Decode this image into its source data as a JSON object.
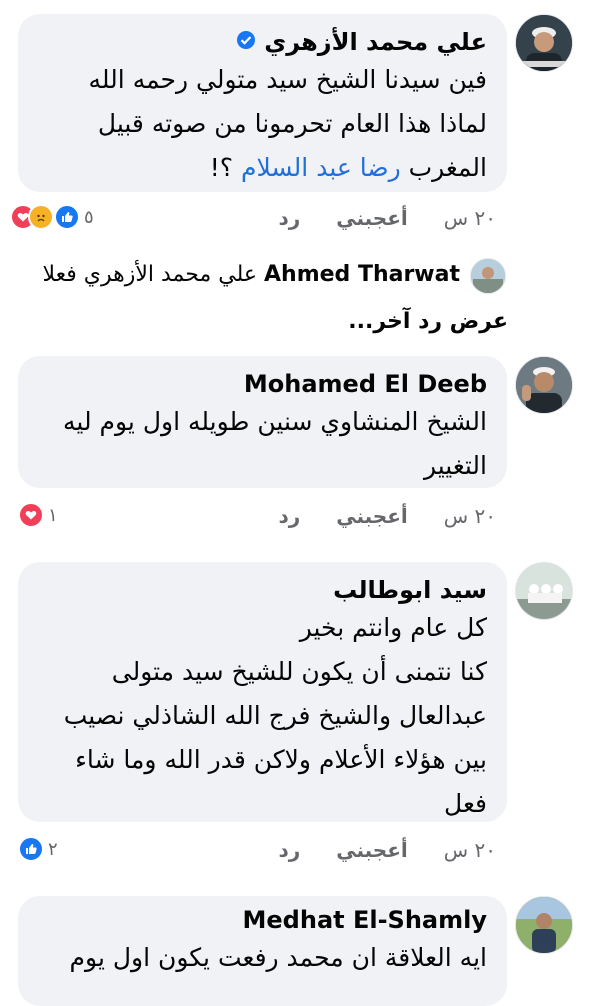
{
  "comments": [
    {
      "author": "علي محمد الأزهري",
      "verified": true,
      "lines": [
        "فين سيدنا الشيخ سيد متولي رحمه الله",
        "لماذا هذا العام تحرمونا من صوته قبيل",
        "المغرب"
      ],
      "mention": "رضا عبد السلام",
      "mention_suffix": " ؟!",
      "time": "٢٠ س",
      "like": "أعجبني",
      "reply": "رد",
      "reaction_count": "٥",
      "reactions": [
        "like-icon",
        "sad-icon",
        "love-icon"
      ]
    },
    {
      "author": "Mohamed El Deeb",
      "lines": [
        "الشيخ المنشاوي سنين طويله اول يوم ليه",
        "التغيير"
      ],
      "time": "٢٠ س",
      "like": "أعجبني",
      "reply": "رد",
      "reaction_count": "١",
      "reactions": [
        "love-icon"
      ]
    },
    {
      "author": "سيد ابوطالب",
      "lines": [
        "كل عام وانتم بخير",
        "كنا نتمنى أن يكون للشيخ سيد متولى",
        "عبدالعال والشيخ فرج الله الشاذلي نصيب",
        "بين هؤلاء الأعلام ولاكن قدر الله وما شاء",
        "فعل"
      ],
      "time": "٢٠ س",
      "like": "أعجبني",
      "reply": "رد",
      "reaction_count": "٢",
      "reactions": [
        "like-icon"
      ]
    },
    {
      "author": "Medhat El-Shamly",
      "lines": [
        "ايه العلاقة ان محمد رفعت يكون اول يوم"
      ]
    }
  ],
  "reply_preview": {
    "author": "Ahmed Tharwat",
    "text": "علي محمد الأزهري فعلا"
  },
  "view_more_replies": "عرض رد آخر...",
  "colors": {
    "bubble": "#f0f2f5",
    "mention": "#216fdb",
    "meta": "#65676b",
    "like_blue": "#1877f2",
    "love_red": "#f33e58",
    "sad_yellow": "#f7b125"
  }
}
